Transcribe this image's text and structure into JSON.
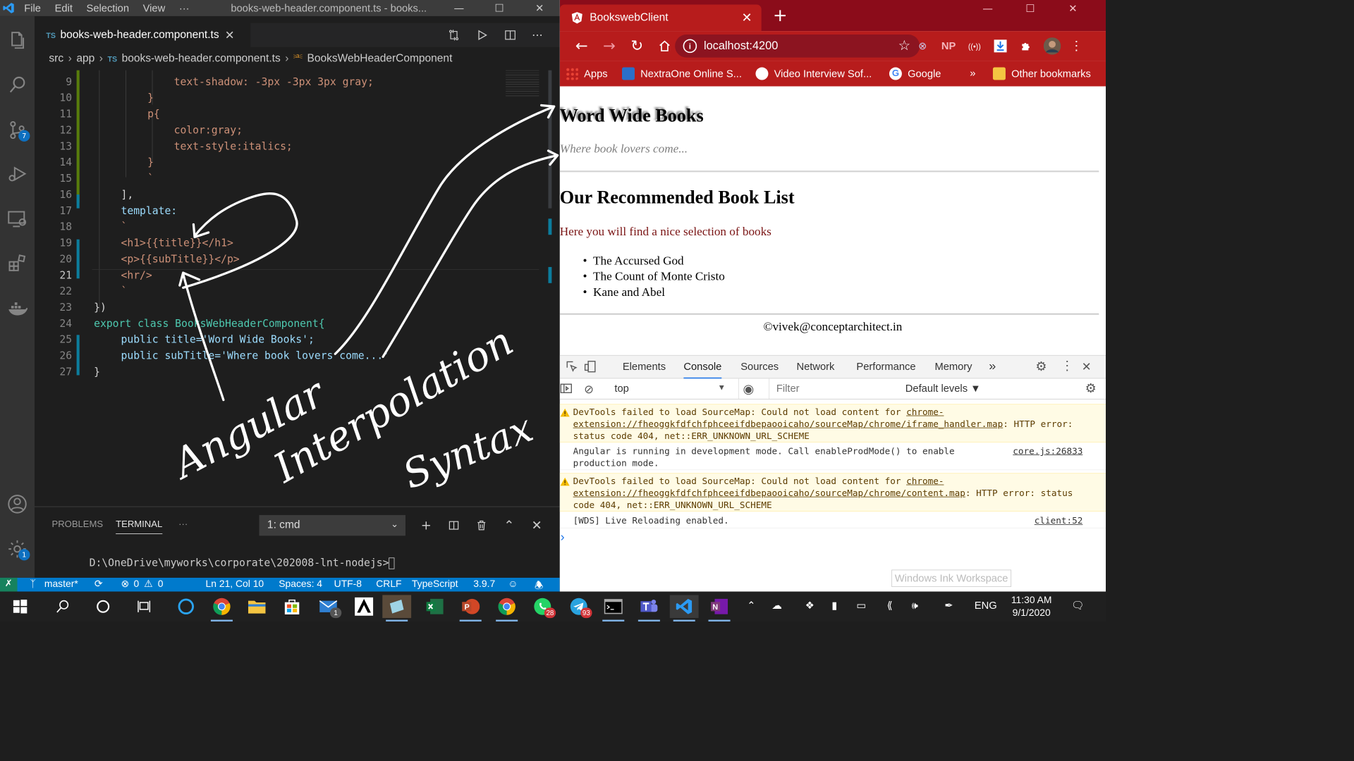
{
  "vscode": {
    "menu": [
      "File",
      "Edit",
      "Selection",
      "View",
      "···"
    ],
    "window_title": "books-web-header.component.ts - books...",
    "tab_label": "books-web-header.component.ts",
    "tab_lang": "TS",
    "breadcrumb": [
      "src",
      "app",
      "books-web-header.component.ts",
      "BooksWebHeaderComponent"
    ],
    "activity_badges": {
      "source_control": "7",
      "settings": "1"
    },
    "code_lines": [
      {
        "n": "9",
        "text": "text-shadow: -3px -3px 3px gray;"
      },
      {
        "n": "10",
        "text": "}"
      },
      {
        "n": "11",
        "text": "p{"
      },
      {
        "n": "12",
        "text": "color:gray;"
      },
      {
        "n": "13",
        "text": "text-style:italics;"
      },
      {
        "n": "14",
        "text": "}"
      },
      {
        "n": "15",
        "text": "`"
      },
      {
        "n": "16",
        "text": "],"
      },
      {
        "n": "17",
        "text": "template:"
      },
      {
        "n": "18",
        "text": "`"
      },
      {
        "n": "19",
        "text": "<h1>{{title}}</h1>"
      },
      {
        "n": "20",
        "text": "<p>{{subTitle}}</p>"
      },
      {
        "n": "21",
        "text": "<hr/>"
      },
      {
        "n": "22",
        "text": "`"
      },
      {
        "n": "23",
        "text": "})"
      },
      {
        "n": "24",
        "text": "export class BooksWebHeaderComponent{"
      },
      {
        "n": "25",
        "text": "public title='Word Wide Books';"
      },
      {
        "n": "26",
        "text": "public subTitle='Where book lovers come...'"
      },
      {
        "n": "27",
        "text": "}"
      }
    ],
    "panel": {
      "tabs": [
        "PROBLEMS",
        "TERMINAL",
        "···"
      ],
      "terminal_select": "1: cmd",
      "terminal_line": "D:\\OneDrive\\myworks\\corporate\\202008-lnt-nodejs>"
    },
    "status": {
      "branch": "master*",
      "errors": "0",
      "warnings": "0",
      "position": "Ln 21, Col 10",
      "spaces": "Spaces: 4",
      "encoding": "UTF-8",
      "eol": "CRLF",
      "language": "TypeScript",
      "ts_version": "3.9.7"
    },
    "handwriting": [
      "Angular",
      "Interpolation",
      "Syntax"
    ]
  },
  "chrome": {
    "tab_title": "BookswebClient",
    "url": "localhost:4200",
    "ext_labels": [
      "NP"
    ],
    "bookmarks": [
      "Apps",
      "NextraOne Online S...",
      "Video Interview Sof...",
      "Google",
      "»",
      "Other bookmarks"
    ],
    "page": {
      "title": "Word Wide Books",
      "subtitle": "Where book lovers come...",
      "list_heading": "Our Recommended Book List",
      "list_intro": "Here you will find a nice selection of books",
      "books": [
        "The Accursed God",
        "The Count of Monte Cristo",
        "Kane and Abel"
      ],
      "footer": "©vivek@conceptarchitect.in"
    },
    "devtools": {
      "tabs": [
        "Elements",
        "Console",
        "Sources",
        "Network",
        "Performance",
        "Memory",
        "»"
      ],
      "context": "top",
      "filter_placeholder": "Filter",
      "levels": "Default levels ▼",
      "messages": [
        {
          "type": "warning",
          "pre": "DevTools failed to load SourceMap: Could not load content for ",
          "link": "chrome-extension://fheoggkfdfchfphceeifdbepaooicaho/sourceMap/chrome/iframe_handler.map",
          "post": ": HTTP error: status code 404, net::ERR_UNKNOWN_URL_SCHEME",
          "source": ""
        },
        {
          "type": "info",
          "pre": "Angular is running in development mode. Call enableProdMode() to enable production mode.",
          "link": "",
          "post": "",
          "source": "core.js:26833"
        },
        {
          "type": "warning",
          "pre": "DevTools failed to load SourceMap: Could not load content for ",
          "link": "chrome-extension://fheoggkfdfchfphceeifdbepaooicaho/sourceMap/chrome/content.map",
          "post": ": HTTP error: status code 404, net::ERR_UNKNOWN_URL_SCHEME",
          "source": ""
        },
        {
          "type": "info",
          "pre": "[WDS] Live Reloading enabled.",
          "link": "",
          "post": "",
          "source": "client:52"
        }
      ],
      "prompt": "›"
    }
  },
  "ink_workspace_label": "Windows Ink Workspace",
  "taskbar": {
    "badges": {
      "outlook": "1",
      "chrome2": "28",
      "telegram": "93"
    },
    "lang": "ENG",
    "time": "11:30 AM",
    "date": "9/1/2020"
  },
  "colors": {
    "vscode_status": "#007acc",
    "chrome_frame": "#b71c1c",
    "ts_blue": "#519aba"
  }
}
